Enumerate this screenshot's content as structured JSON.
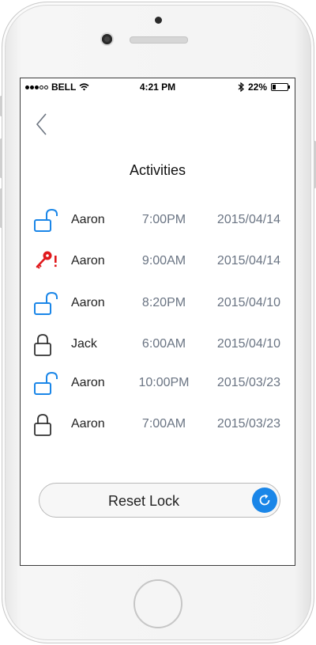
{
  "status_bar": {
    "carrier": "BELL",
    "time": "4:21 PM",
    "battery": "22%",
    "battery_level": 0.22
  },
  "colors": {
    "accent": "#1a86e8",
    "alert": "#e0191c",
    "muted_text": "#6a7483"
  },
  "page": {
    "title": "Activities",
    "back_icon": "chevron-left-icon"
  },
  "activities": [
    {
      "icon": "unlocked-padlock-icon",
      "name": "Aaron",
      "time": "7:00PM",
      "date": "2015/04/14"
    },
    {
      "icon": "key-alert-icon",
      "name": "Aaron",
      "time": "9:00AM",
      "date": "2015/04/14"
    },
    {
      "icon": "unlocked-padlock-icon",
      "name": "Aaron",
      "time": "8:20PM",
      "date": "2015/04/10"
    },
    {
      "icon": "locked-padlock-icon",
      "name": "Jack",
      "time": "6:00AM",
      "date": "2015/04/10"
    },
    {
      "icon": "unlocked-padlock-icon",
      "name": "Aaron",
      "time": "10:00PM",
      "date": "2015/03/23"
    },
    {
      "icon": "locked-padlock-icon",
      "name": "Aaron",
      "time": "7:00AM",
      "date": "2015/03/23"
    }
  ],
  "reset_button": {
    "label": "Reset Lock",
    "icon": "refresh-icon"
  }
}
